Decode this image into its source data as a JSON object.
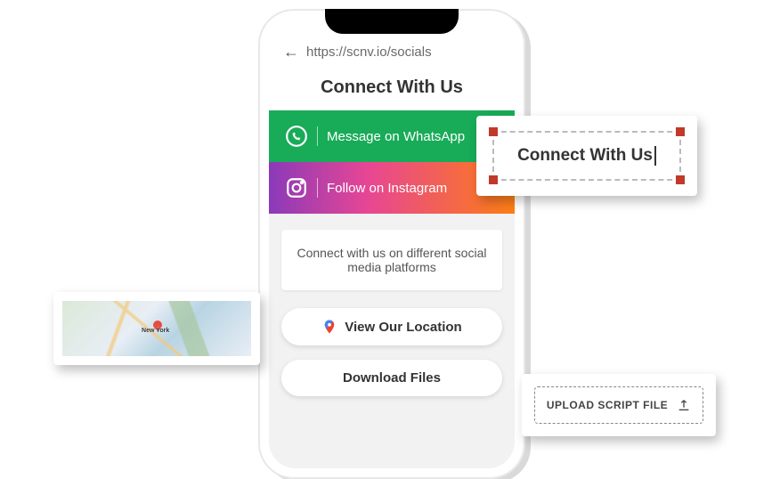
{
  "phone": {
    "url": "https://scnv.io/socials",
    "title": "Connect With Us",
    "whatsapp_label": "Message on WhatsApp",
    "instagram_label": "Follow on Instagram",
    "description": "Connect with us on different social media platforms",
    "location_label": "View Our Location",
    "download_label": "Download Files"
  },
  "editor": {
    "text": "Connect With Us"
  },
  "map": {
    "city_label": "New York"
  },
  "upload": {
    "label": "UPLOAD SCRIPT FILE"
  }
}
